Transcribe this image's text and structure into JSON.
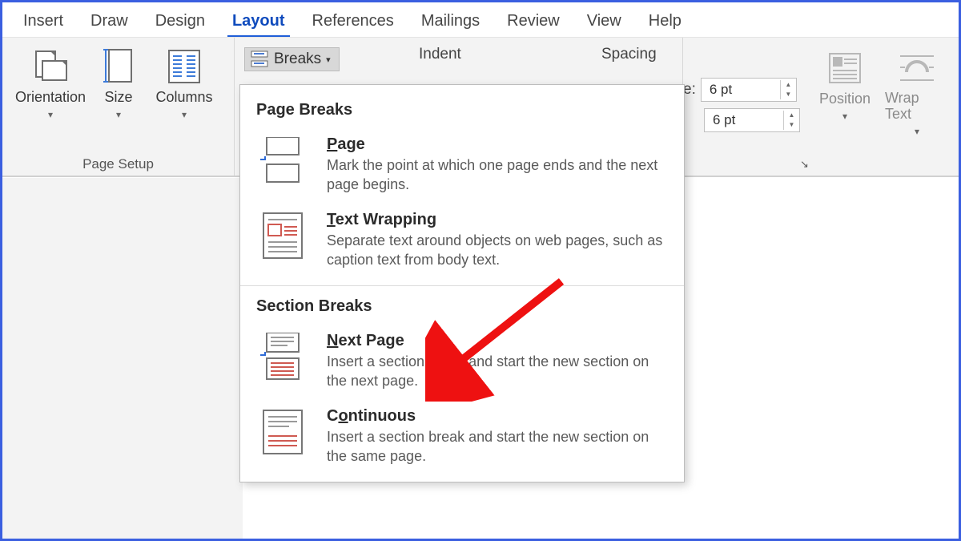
{
  "tabs": [
    "Insert",
    "Draw",
    "Design",
    "Layout",
    "References",
    "Mailings",
    "Review",
    "View",
    "Help"
  ],
  "active_tab": "Layout",
  "page_setup": {
    "orientation": "Orientation",
    "size": "Size",
    "columns": "Columns",
    "breaks": "Breaks",
    "group_label": "Page Setup"
  },
  "paragraph": {
    "indent_label": "Indent",
    "spacing_label": "Spacing",
    "before_suffix_label": "e:",
    "before_value": "6 pt",
    "after_value": "6 pt"
  },
  "arrange": {
    "position": "Position",
    "wrap": "Wrap Text"
  },
  "dropdown": {
    "section1": "Page Breaks",
    "section2": "Section Breaks",
    "items": [
      {
        "title_pre": "",
        "title_u": "P",
        "title_post": "age",
        "desc": "Mark the point at which one page ends and the next page begins."
      },
      {
        "title_pre": "",
        "title_u": "T",
        "title_post": "ext Wrapping",
        "desc": "Separate text around objects on web pages, such as caption text from body text."
      },
      {
        "title_pre": "",
        "title_u": "N",
        "title_post": "ext Page",
        "desc": "Insert a section break and start the new section on the next page."
      },
      {
        "title_pre": "C",
        "title_u": "o",
        "title_post": "ntinuous",
        "desc": "Insert a section break and start the new section on the same page."
      }
    ]
  }
}
